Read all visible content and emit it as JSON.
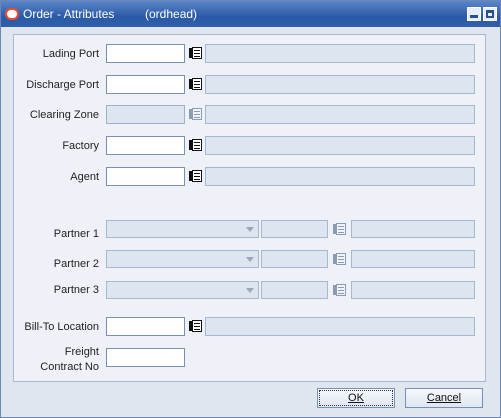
{
  "window": {
    "title": "Order - Attributes",
    "subtitle": "(ordhead)"
  },
  "fields": {
    "lading_port": "Lading Port",
    "discharge_port": "Discharge Port",
    "clearing_zone": "Clearing Zone",
    "factory": "Factory",
    "agent": "Agent",
    "partner1": "Partner 1",
    "partner2": "Partner 2",
    "partner3": "Partner 3",
    "bill_to_location": "Bill-To Location",
    "freight_line1": "Freight",
    "freight_line2": "Contract No"
  },
  "buttons": {
    "ok": "OK",
    "cancel": "Cancel"
  },
  "colors": {
    "titlebar": "#2a5aa7",
    "panel": "#eef2f8",
    "disabled_field": "#dde5f0"
  }
}
